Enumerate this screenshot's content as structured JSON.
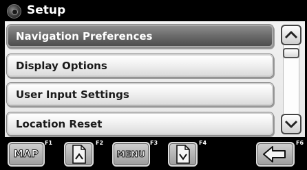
{
  "title": {
    "text": "Setup",
    "icon": "gear-disc-icon"
  },
  "menu": {
    "items": [
      {
        "label": "Navigation Preferences",
        "state": "selected"
      },
      {
        "label": "Display Options",
        "state": "normal"
      },
      {
        "label": "User Input Settings",
        "state": "normal"
      },
      {
        "label": "Location Reset",
        "state": "normal"
      }
    ]
  },
  "scrollbar": {
    "up_icon": "chevron-up-icon",
    "down_icon": "chevron-down-icon"
  },
  "function_keys": [
    {
      "key": "F1",
      "label": "MAP",
      "icon": null
    },
    {
      "key": "F2",
      "label": "",
      "icon": "page-up-icon"
    },
    {
      "key": "F3",
      "label": "MENU",
      "icon": null
    },
    {
      "key": "F4",
      "label": "",
      "icon": "page-down-icon"
    },
    {
      "key": "F6",
      "label": "",
      "icon": "back-arrow-icon"
    }
  ],
  "colors": {
    "background": "#000000",
    "panel": "#eeeeee",
    "selected_item": "#6a6a6a"
  }
}
